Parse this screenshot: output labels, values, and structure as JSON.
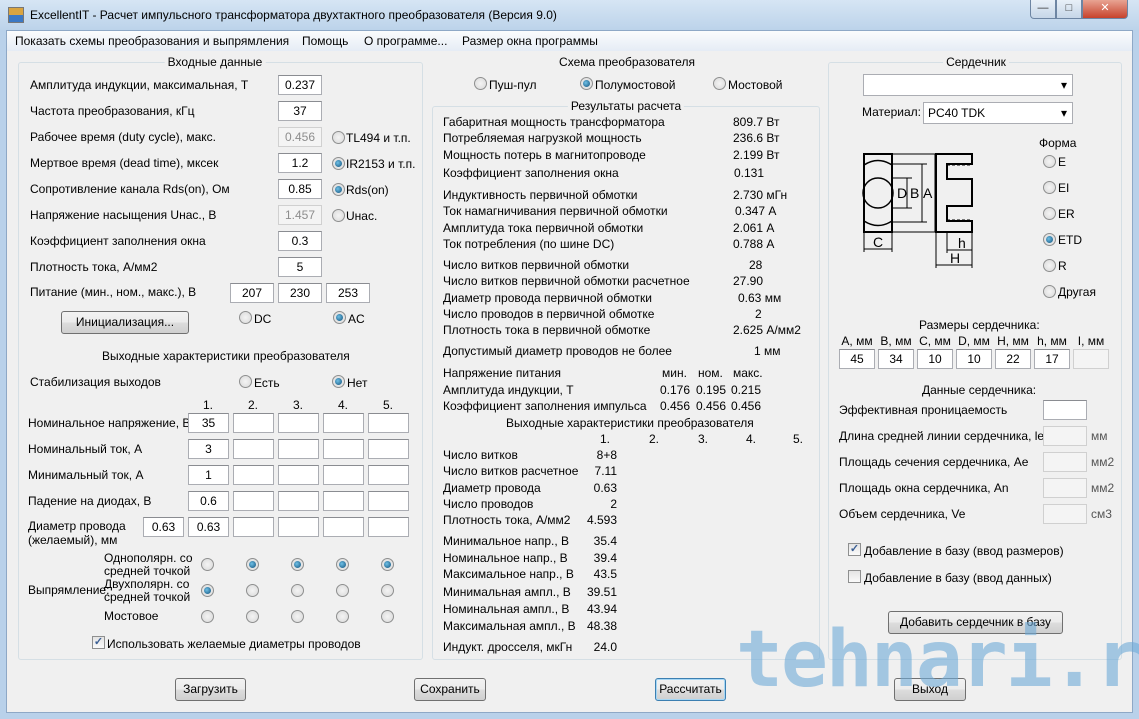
{
  "window": {
    "title": "ExcellentIT - Расчет импульсного трансформатора двухтактного преобразователя (Версия 9.0)",
    "minimize": "—",
    "maximize": "□",
    "close": "✕"
  },
  "menu": [
    "Показать схемы преобразования и выпрямления",
    "Помощь",
    "О программе...",
    "Размер окна программы"
  ],
  "input": {
    "title": "Входные данные",
    "rows": [
      {
        "label": "Амплитуда индукции, максимальная, Т",
        "value": "0.237"
      },
      {
        "label": "Частота преобразования, кГц",
        "value": "37"
      },
      {
        "label": "Рабочее время (duty cycle), макс.",
        "value": "0.456",
        "disabled": true,
        "radio": "TL494 и т.п.",
        "radio_on": false
      },
      {
        "label": "Мертвое время (dead time), мксек",
        "value": "1.2",
        "radio": "IR2153 и т.п.",
        "radio_on": true
      },
      {
        "label": "Сопротивление канала Rds(on), Ом",
        "value": "0.85",
        "radio": "Rds(on)",
        "radio_on": true
      },
      {
        "label": "Напряжение насыщения Uнас., В",
        "value": "1.457",
        "disabled": true,
        "radio": "Uнас.",
        "radio_on": false
      },
      {
        "label": "Коэффициент заполнения окна",
        "value": "0.3"
      },
      {
        "label": "Плотность тока, А/мм2",
        "value": "5"
      }
    ],
    "supply_label": "Питание (мин., ном., макс.), В",
    "supply": [
      "207",
      "230",
      "253"
    ],
    "init_button": "Инициализация...",
    "dc": "DC",
    "ac": "AC",
    "ac_selected": true
  },
  "output": {
    "title": "Выходные характеристики преобразователя",
    "stab_label": "Стабилизация выходов",
    "stab_yes": "Есть",
    "stab_no": "Нет",
    "stab_selected": "Нет",
    "columns": [
      "1.",
      "2.",
      "3.",
      "4.",
      "5."
    ],
    "rows": [
      {
        "label": "Номинальное напряжение, В",
        "values": [
          "35",
          "",
          "",
          "",
          ""
        ]
      },
      {
        "label": "Номинальный ток, А",
        "values": [
          "3",
          "",
          "",
          "",
          ""
        ]
      },
      {
        "label": "Минимальный ток, А",
        "values": [
          "1",
          "",
          "",
          "",
          ""
        ]
      },
      {
        "label": "Падение на диодах, В",
        "values": [
          "0.6",
          "",
          "",
          "",
          ""
        ]
      },
      {
        "label": "Диаметр провода\n(желаемый), мм",
        "values": [
          "0.63",
          "",
          "",
          "",
          ""
        ],
        "desired": "0.63"
      }
    ],
    "rect_label": "Выпрямление:",
    "rect_modes": [
      {
        "label": "Однополярн. со\nсредней точкой",
        "selected": [
          false,
          true,
          true,
          true,
          true
        ]
      },
      {
        "label": "Двухполярн. со\nсредней точкой",
        "selected": [
          true,
          false,
          false,
          false,
          false
        ]
      },
      {
        "label": "Мостовое",
        "selected": [
          false,
          false,
          false,
          false,
          false
        ]
      }
    ],
    "use_desired": "Использовать желаемые диаметры проводов",
    "use_desired_checked": true
  },
  "scheme": {
    "title": "Схема преобразователя",
    "options": [
      "Пуш-пул",
      "Полумостовой",
      "Мостовой"
    ],
    "selected": 1
  },
  "results": {
    "title": "Результаты расчета",
    "rows": [
      [
        "Габаритная мощность трансформатора",
        "809.7 Вт"
      ],
      [
        "Потребляемая нагрузкой мощность",
        "236.6 Вт"
      ],
      [
        "Мощность потерь в магнитопроводе",
        "2.199 Вт"
      ],
      [
        "Коэффициент заполнения окна",
        "0.131"
      ],
      [
        "Индуктивность первичной обмотки",
        "2.730 мГн"
      ],
      [
        "Ток намагничивания первичной обмотки",
        "0.347 А"
      ],
      [
        "Амплитуда тока первичной обмотки",
        "2.061 А"
      ],
      [
        "Ток потребления (по шине DC)",
        "0.788 А"
      ],
      [
        "Число витков первичной обмотки",
        "28"
      ],
      [
        "Число витков первичной обмотки расчетное",
        "27.90"
      ],
      [
        "Диаметр провода первичной обмотки",
        "0.63 мм"
      ],
      [
        "Число проводов в первичной обмотке",
        "2"
      ],
      [
        "Плотность тока в первичной обмотке",
        "2.625 А/мм2"
      ],
      [
        "Допустимый диаметр проводов не более",
        "1 мм"
      ]
    ],
    "supply_header": [
      "Напряжение питания",
      "мин.",
      "ном.",
      "макс."
    ],
    "supply_rows": [
      [
        "Амплитуда индукции, Т",
        "0.176",
        "0.195",
        "0.215"
      ],
      [
        "Коэффициент заполнения импульса",
        "0.456",
        "0.456",
        "0.456"
      ]
    ],
    "out_title": "Выходные характеристики преобразователя",
    "out_columns": [
      "1.",
      "2.",
      "3.",
      "4.",
      "5."
    ],
    "out_rows": [
      [
        "Число витков",
        "8+8"
      ],
      [
        "Число витков расчетное",
        "7.11"
      ],
      [
        "Диаметр провода",
        "0.63"
      ],
      [
        "Число проводов",
        "2"
      ],
      [
        "Плотность тока, А/мм2",
        "4.593"
      ],
      [
        "Минимальное напр., В",
        "35.4"
      ],
      [
        "Номинальное напр., В",
        "39.4"
      ],
      [
        "Максимальное напр., В",
        "43.5"
      ],
      [
        "Минимальная ампл., В",
        "39.51"
      ],
      [
        "Номинальная ампл., В",
        "43.94"
      ],
      [
        "Максимальная ампл., В",
        "48.38"
      ],
      [
        "Индукт. дросселя, мкГн",
        "24.0"
      ]
    ]
  },
  "core": {
    "title": "Сердечник",
    "core_select": "",
    "material_label": "Материал:",
    "material": "PC40 TDK",
    "shape_title": "Форма",
    "shapes": [
      "E",
      "EI",
      "ER",
      "ETD",
      "R",
      "Другая"
    ],
    "shape_selected": 3,
    "drawing_labels": [
      "D",
      "B",
      "A",
      "C",
      "h",
      "H"
    ],
    "dims_title": "Размеры сердечника:",
    "dims": [
      [
        "A, мм",
        "45"
      ],
      [
        "B, мм",
        "34"
      ],
      [
        "C, мм",
        "10"
      ],
      [
        "D, мм",
        "10"
      ],
      [
        "H, мм",
        "22"
      ],
      [
        "h, мм",
        "17"
      ],
      [
        "I, мм",
        ""
      ]
    ],
    "data_title": "Данные сердечника:",
    "data": [
      [
        "Эффективная проницаемость",
        "",
        ""
      ],
      [
        "Длина средней линии сердечника, le",
        "",
        "мм"
      ],
      [
        "Площадь сечения сердечника, Ae",
        "",
        "мм2"
      ],
      [
        "Площадь окна сердечника, An",
        "",
        "мм2"
      ],
      [
        "Объем сердечника, Ve",
        "",
        "см3"
      ]
    ],
    "add_sizes": "Добавление в базу (ввод размеров)",
    "add_sizes_checked": true,
    "add_data": "Добавление в базу (ввод данных)",
    "add_data_checked": false,
    "add_button": "Добавить сердечник в базу"
  },
  "buttons": {
    "load": "Загрузить",
    "save": "Сохранить",
    "calc": "Рассчитать",
    "exit": "Выход"
  },
  "watermark": "tehnari.ru"
}
